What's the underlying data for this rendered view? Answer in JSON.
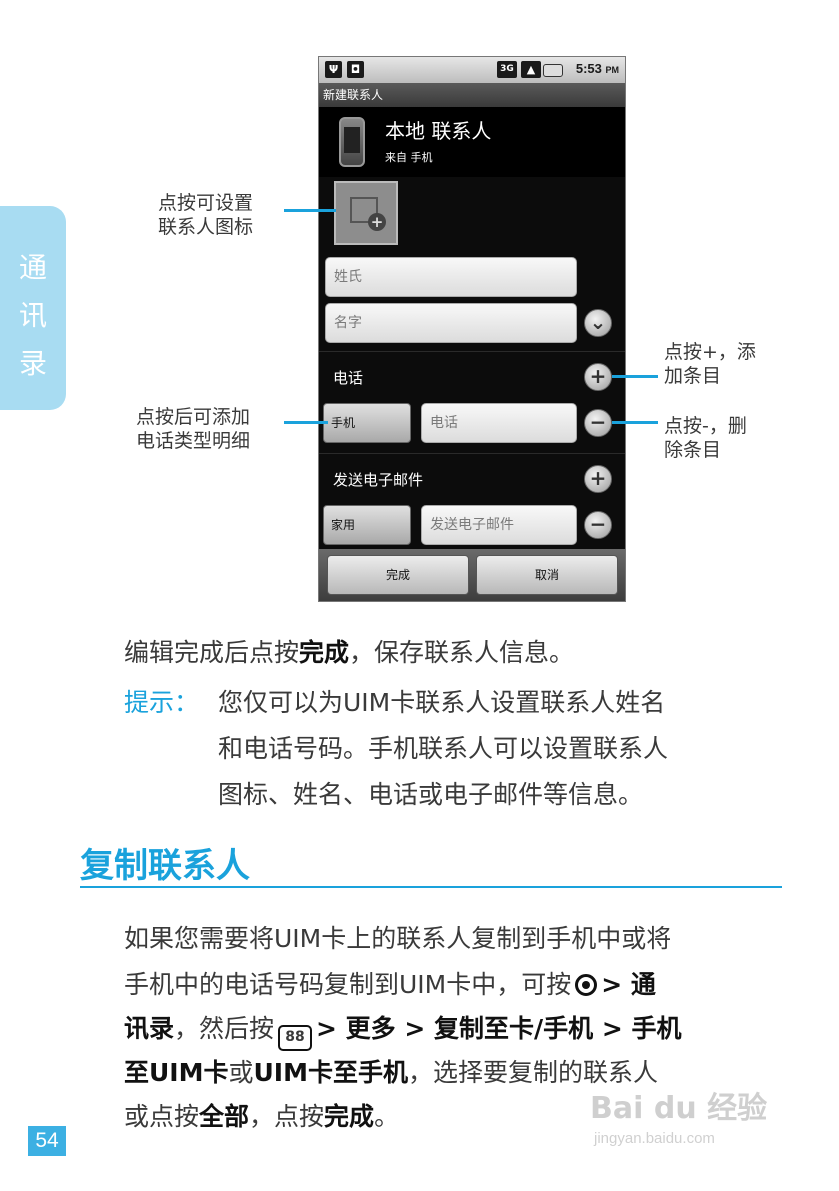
{
  "side_tab": {
    "chars": [
      "通",
      "讯",
      "录"
    ]
  },
  "phone": {
    "status_bar": {
      "network": "3G",
      "time": "5:53",
      "ampm": "PM"
    },
    "title": "新建联系人",
    "account": {
      "title": "本地 联系人",
      "subtitle": "来自 手机"
    },
    "fields": {
      "surname_placeholder": "姓氏",
      "given_name_placeholder": "名字",
      "phone_section": "电话",
      "phone_type": "手机",
      "phone_placeholder": "电话",
      "email_section": "发送电子邮件",
      "email_type": "家用",
      "email_placeholder": "发送电子邮件"
    },
    "buttons": {
      "done": "完成",
      "cancel": "取消"
    }
  },
  "callouts": {
    "photo": [
      "点按可设置",
      "联系人图标"
    ],
    "type": [
      "点按后可添加",
      "电话类型明细"
    ],
    "add": [
      "点按+，添",
      "加条目"
    ],
    "remove": [
      "点按-，删",
      "除条目"
    ]
  },
  "body": {
    "line1_pre": "编辑完成后点按",
    "line1_bold": "完成",
    "line1_post": "，保存联系人信息。",
    "tip_label": "提示：",
    "tip_lines": [
      "您仅可以为UIM卡联系人设置联系人姓名",
      "和电话号码。手机联系人可以设置联系人",
      "图标、姓名、电话或电子邮件等信息。"
    ],
    "section_heading": "复制联系人",
    "copy": {
      "l1": "如果您需要将UIM卡上的联系人复制到手机中或将",
      "l2_pre": "手机中的电话号码复制到UIM卡中，可按",
      "l2_bold": "> 通",
      "l3_b1": "讯录",
      "l3_t1": "，然后按",
      "l3_b2": "> 更多 > 复制至卡/手机 > 手机",
      "l4_b1": "至UIM卡",
      "l4_t1": "或",
      "l4_b2": "UIM卡至手机",
      "l4_t2": "，选择要复制的联系人",
      "l5_t1": "或点按",
      "l5_b1": "全部",
      "l5_t2": "，点按",
      "l5_b2": "完成",
      "l5_t3": "。"
    },
    "menu_key_glyph": "88"
  },
  "page_number": "54",
  "watermark": {
    "text": "Bai du 经验",
    "url": "jingyan.baidu.com"
  },
  "colors": {
    "accent": "#1aa2dc",
    "side_tab": "#a8dcf2"
  }
}
